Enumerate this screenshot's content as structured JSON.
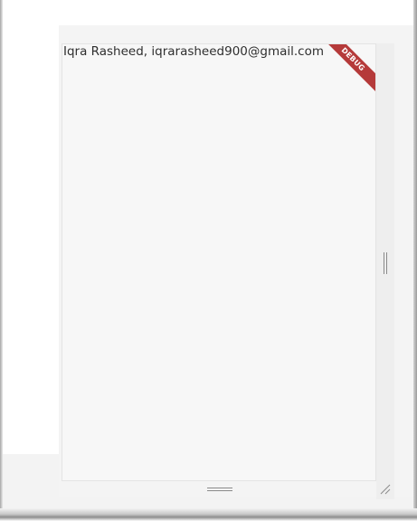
{
  "app": {
    "user_line": "Iqra Rasheed, iqrarasheed900@gmail.com",
    "debug_banner": "DEBUG"
  },
  "colors": {
    "debug_banner": "#b53a3a",
    "screen_background": "#f7f7f7",
    "text": "#2f2f2f"
  },
  "icons": {
    "vertical_resize": "vertical-resize-handle-icon",
    "horizontal_resize": "horizontal-resize-handle-icon",
    "corner_resize": "corner-resize-grip-icon"
  }
}
